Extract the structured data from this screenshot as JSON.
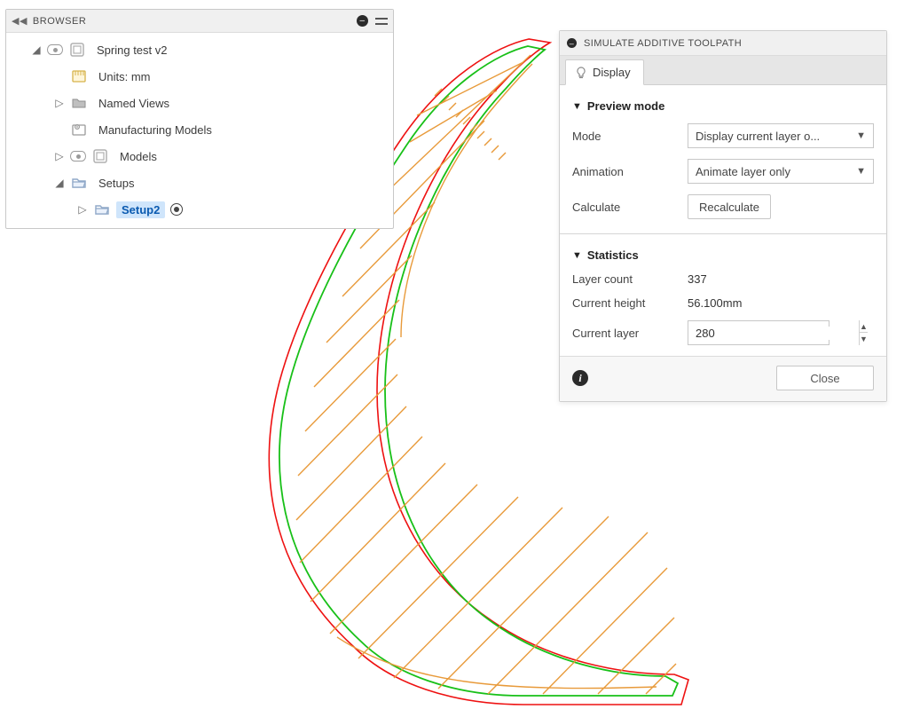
{
  "browser": {
    "title": "BROWSER",
    "tree": {
      "root": {
        "label": "Spring test v2"
      },
      "units": {
        "label": "Units: mm"
      },
      "named_views": {
        "label": "Named Views"
      },
      "mfg_models": {
        "label": "Manufacturing Models"
      },
      "models": {
        "label": "Models"
      },
      "setups": {
        "label": "Setups"
      },
      "setup2": {
        "label": "Setup2"
      }
    }
  },
  "sim_panel": {
    "title": "SIMULATE ADDITIVE TOOLPATH",
    "tab": "Display",
    "preview_mode": {
      "title": "Preview mode",
      "mode_label": "Mode",
      "mode_value": "Display current layer o...",
      "animation_label": "Animation",
      "animation_value": "Animate layer only",
      "calculate_label": "Calculate",
      "calculate_btn": "Recalculate"
    },
    "statistics": {
      "title": "Statistics",
      "layer_count_label": "Layer count",
      "layer_count_value": "337",
      "current_height_label": "Current height",
      "current_height_value": "56.100mm",
      "current_layer_label": "Current layer",
      "current_layer_value": "280"
    },
    "close": "Close"
  }
}
